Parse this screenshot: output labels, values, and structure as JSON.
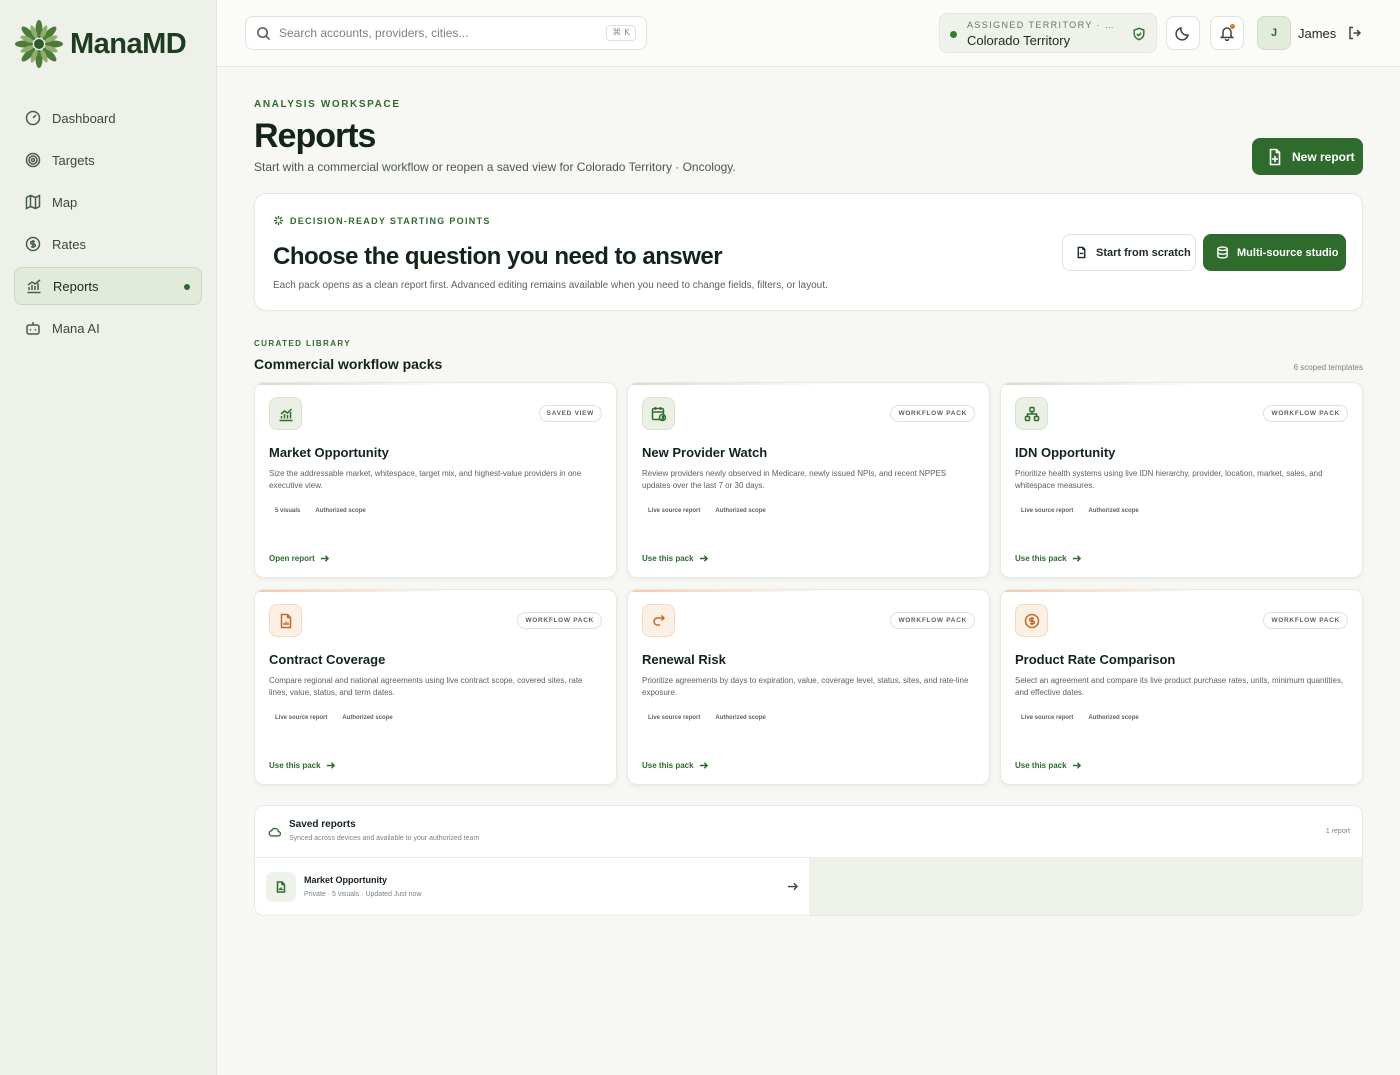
{
  "brand": {
    "name": "ManaMD"
  },
  "sidebar": {
    "items": [
      {
        "label": "Dashboard",
        "icon": "gauge-icon"
      },
      {
        "label": "Targets",
        "icon": "target-icon"
      },
      {
        "label": "Map",
        "icon": "map-icon"
      },
      {
        "label": "Rates",
        "icon": "dollar-icon"
      },
      {
        "label": "Reports",
        "icon": "chart-icon",
        "active": true
      },
      {
        "label": "Mana AI",
        "icon": "bot-icon"
      }
    ]
  },
  "topbar": {
    "search_placeholder": "Search accounts, providers, cities...",
    "shortcut": "⌘ K",
    "territory_label": "ASSIGNED TERRITORY · ONCOLOGY",
    "territory_value": "Colorado Territory",
    "user_initial": "J",
    "user_name": "James"
  },
  "page": {
    "eyebrow": "ANALYSIS WORKSPACE",
    "title": "Reports",
    "subtitle": "Start with a commercial workflow or reopen a saved view for Colorado Territory · Oncology.",
    "new_button": "New report"
  },
  "hero": {
    "eyebrow": "DECISION-READY STARTING POINTS",
    "title": "Choose the question you need to answer",
    "subtitle": "Each pack opens as a clean report first. Advanced editing remains available when you need to change fields, filters, or layout.",
    "scratch_button": "Start from scratch",
    "studio_button": "Multi-source studio"
  },
  "library": {
    "eyebrow": "CURATED LIBRARY",
    "title": "Commercial workflow packs",
    "count": "6 scoped templates",
    "cards": [
      {
        "title": "Market Opportunity",
        "badge": "SAVED VIEW",
        "desc": "Size the addressable market, whitespace, target mix, and highest-value providers in one executive view.",
        "tags": [
          "5 visuals",
          "Authorized scope"
        ],
        "cta": "Open report",
        "icon": "trend-chart-icon",
        "tone": "green"
      },
      {
        "title": "New Provider Watch",
        "badge": "WORKFLOW PACK",
        "desc": "Review providers newly observed in Medicare, newly issued NPIs, and recent NPPES updates over the last 7 or 30 days.",
        "tags": [
          "Live source report",
          "Authorized scope"
        ],
        "cta": "Use this pack",
        "icon": "calendar-clock-icon",
        "tone": "green"
      },
      {
        "title": "IDN Opportunity",
        "badge": "WORKFLOW PACK",
        "desc": "Prioritize health systems using live IDN hierarchy, provider, location, market, sales, and whitespace measures.",
        "tags": [
          "Live source report",
          "Authorized scope"
        ],
        "cta": "Use this pack",
        "icon": "hierarchy-icon",
        "tone": "green"
      },
      {
        "title": "Contract Coverage",
        "badge": "WORKFLOW PACK",
        "desc": "Compare regional and national agreements using live contract scope, covered sites, rate lines, value, status, and term dates.",
        "tags": [
          "Live source report",
          "Authorized scope"
        ],
        "cta": "Use this pack",
        "icon": "document-chart-icon",
        "tone": "orange"
      },
      {
        "title": "Renewal Risk",
        "badge": "WORKFLOW PACK",
        "desc": "Prioritize agreements by days to expiration, value, coverage level, status, sites, and rate-line exposure.",
        "tags": [
          "Live source report",
          "Authorized scope"
        ],
        "cta": "Use this pack",
        "icon": "redo-arrow-icon",
        "tone": "orange"
      },
      {
        "title": "Product Rate Comparison",
        "badge": "WORKFLOW PACK",
        "desc": "Select an agreement and compare its live product purchase rates, units, minimum quantities, and effective dates.",
        "tags": [
          "Live source report",
          "Authorized scope"
        ],
        "cta": "Use this pack",
        "icon": "dollar-circle-icon",
        "tone": "orange"
      }
    ]
  },
  "saved": {
    "title": "Saved reports",
    "subtitle": "Synced across devices and available to your authorized team",
    "count": "1 report",
    "items": [
      {
        "title": "Market Opportunity",
        "meta": "Private · 5 visuals · Updated Just now"
      }
    ]
  },
  "colors": {
    "accent": "#2f6b2d",
    "orange": "#d77a2a"
  }
}
